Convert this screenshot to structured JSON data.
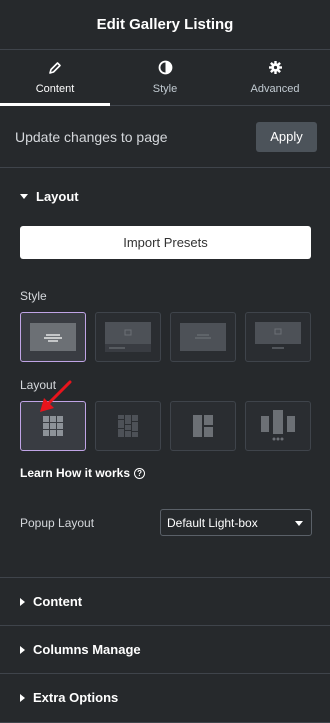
{
  "header": {
    "title": "Edit Gallery Listing"
  },
  "tabs": [
    {
      "label": "Content",
      "icon": "pencil-icon",
      "active": true
    },
    {
      "label": "Style",
      "icon": "contrast-icon",
      "active": false
    },
    {
      "label": "Advanced",
      "icon": "gear-icon",
      "active": false
    }
  ],
  "update": {
    "text": "Update changes to page",
    "apply_label": "Apply"
  },
  "layout_section": {
    "title": "Layout",
    "import_label": "Import Presets",
    "style_label": "Style",
    "layout_label": "Layout",
    "learn_label": "Learn How it works",
    "popup_label": "Popup Layout",
    "popup_value": "Default Light-box"
  },
  "sections": [
    {
      "title": "Content"
    },
    {
      "title": "Columns Manage"
    },
    {
      "title": "Extra Options"
    }
  ],
  "colors": {
    "background": "#26292c",
    "selected_border": "#c0a4e6",
    "annotation_arrow": "#e8141c"
  }
}
